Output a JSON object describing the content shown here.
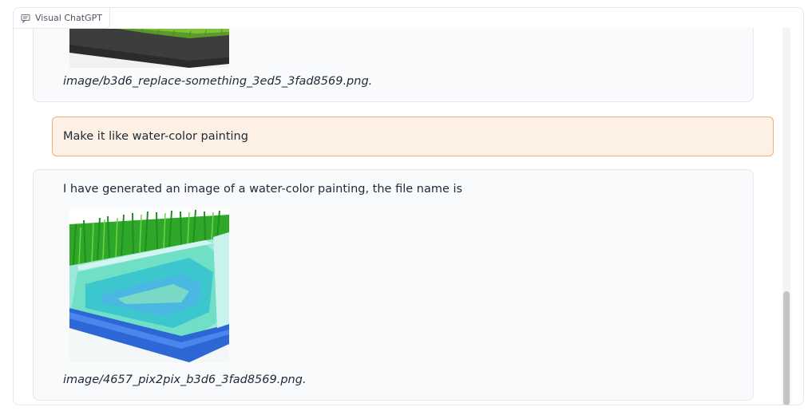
{
  "app": {
    "tab_label": "Visual ChatGPT",
    "tab_icon": "chat-bubble-icon"
  },
  "messages": [
    {
      "role": "bot",
      "image_desc": "replace-something-image",
      "filename": "image/b3d6_replace-something_3ed5_3fad8569.png."
    },
    {
      "role": "user",
      "text": "Make it like water-color painting"
    },
    {
      "role": "bot",
      "text": "I have generated an image of a water-color painting, the file name is",
      "image_desc": "pix2pix-watercolor-image",
      "filename": "image/4657_pix2pix_b3d6_3fad8569.png."
    }
  ],
  "colors": {
    "user_bubble_bg": "#fdf0e4",
    "user_bubble_border": "#f0b07a",
    "bot_bubble_bg": "#f8fafc"
  }
}
